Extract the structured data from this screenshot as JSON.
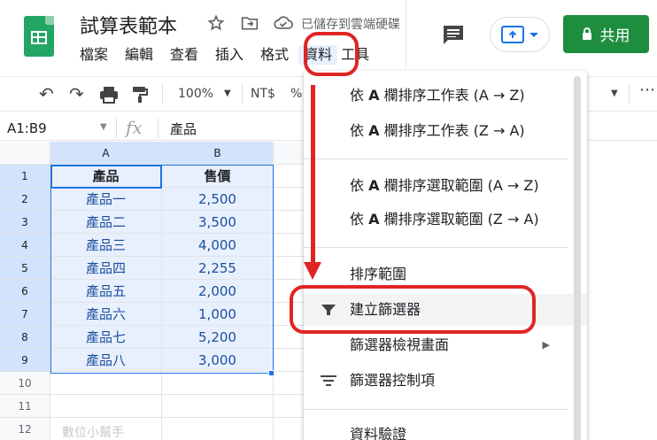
{
  "app": {
    "doc_title": "試算表範本",
    "save_status": "已儲存到雲端硬碟"
  },
  "menu": [
    "檔案",
    "編輯",
    "查看",
    "插入",
    "格式",
    "資料",
    "工具"
  ],
  "share": {
    "label": "共用"
  },
  "toolbar": {
    "zoom": "100%",
    "currency": "NT$",
    "percent": "%"
  },
  "formula_bar": {
    "range": "A1:B9",
    "fx": "fx",
    "content": "產品"
  },
  "grid": {
    "columns": [
      "A",
      "B"
    ],
    "row_numbers": [
      "1",
      "2",
      "3",
      "4",
      "5",
      "6",
      "7",
      "8",
      "9",
      "10",
      "11",
      "12"
    ],
    "header": {
      "a": "產品",
      "b": "售價"
    },
    "rows": [
      {
        "a": "產品一",
        "b": "2,500"
      },
      {
        "a": "產品二",
        "b": "3,500"
      },
      {
        "a": "產品三",
        "b": "4,000"
      },
      {
        "a": "產品四",
        "b": "2,255"
      },
      {
        "a": "產品五",
        "b": "2,000"
      },
      {
        "a": "產品六",
        "b": "1,000"
      },
      {
        "a": "產品七",
        "b": "5,200"
      },
      {
        "a": "產品八",
        "b": "3,000"
      }
    ]
  },
  "data_menu": {
    "sort_sheet_az_pre": "依 ",
    "col_letter": "A",
    "sort_sheet_az_post": " 欄排序工作表 (A → Z)",
    "sort_sheet_za_post": " 欄排序工作表 (Z → A)",
    "sort_range_az_post": " 欄排序選取範圍 (A → Z)",
    "sort_range_za_post": " 欄排序選取範圍 (Z → A)",
    "sort_range": "排序範圍",
    "create_filter": "建立篩選器",
    "filter_views": "篩選器檢視畫面",
    "slicer": "篩選器控制項",
    "data_validation": "資料驗證"
  },
  "watermark": "數位小幫手",
  "colors": {
    "accent": "#1a73e8",
    "share_green": "#1e8e3e",
    "annotation_red": "#e02424"
  }
}
